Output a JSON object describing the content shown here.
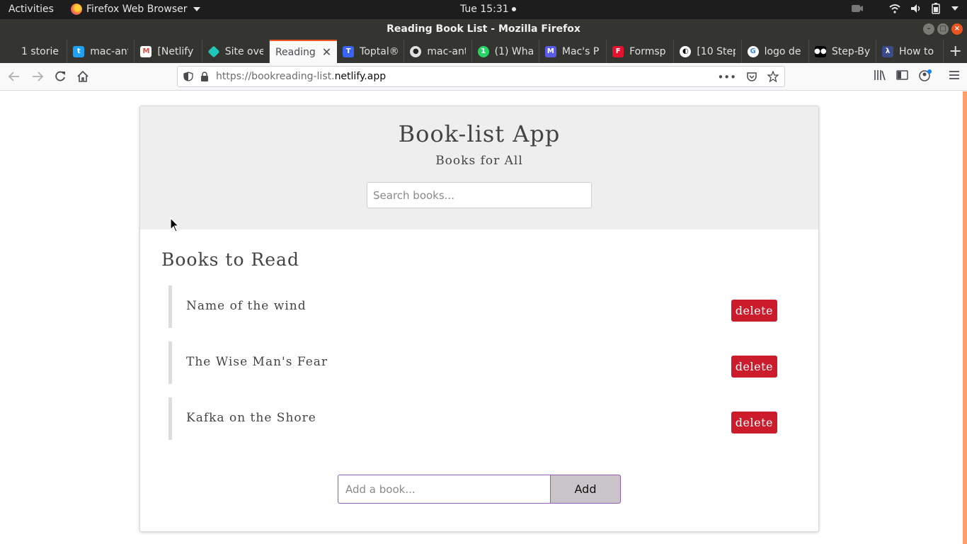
{
  "desktop": {
    "activities": "Activities",
    "app_menu": "Firefox Web Browser",
    "clock": "Tue 15:31"
  },
  "window": {
    "title": "Reading Book List - Mozilla Firefox"
  },
  "tabs": [
    {
      "label": "1 storie",
      "icon": "tab-icon",
      "color": "#343431"
    },
    {
      "label": "mac-ant",
      "icon": "twitter-icon",
      "color": "#1da1f2"
    },
    {
      "label": "[Netlify",
      "icon": "gmail-icon",
      "color": "#ea4335"
    },
    {
      "label": "Site ove",
      "icon": "netlify-icon",
      "color": "#20c6b7"
    },
    {
      "label": "Reading",
      "icon": "none",
      "color": "#f9f9fa",
      "active": true
    },
    {
      "label": "Toptal®",
      "icon": "toptal-icon",
      "color": "#3863f5"
    },
    {
      "label": "mac-ant",
      "icon": "github-icon",
      "color": "#e0e0e0"
    },
    {
      "label": "(1) Wha",
      "icon": "whatsapp-icon",
      "color": "#25d366"
    },
    {
      "label": "Mac's P",
      "icon": "mac-icon",
      "color": "#5a5ce6"
    },
    {
      "label": "Formsp",
      "icon": "formspree-icon",
      "color": "#e5122e"
    },
    {
      "label": "[10 Step",
      "icon": "yin-yang-icon",
      "color": "#ffffff"
    },
    {
      "label": "logo de",
      "icon": "google-icon",
      "color": "#4285f4"
    },
    {
      "label": "Step-By",
      "icon": "medium-icon",
      "color": "#000000"
    },
    {
      "label": "How to",
      "icon": "lambda-icon",
      "color": "#3b4a8a"
    }
  ],
  "urlbar": {
    "url_prefix": "https://bookreading-list.",
    "url_domain": "netlify.app"
  },
  "app": {
    "title": "Book-list App",
    "subtitle": "Books for All",
    "search_placeholder": "Search books...",
    "list_title": "Books to Read",
    "books": [
      {
        "name": "Name of the wind",
        "delete_label": "delete"
      },
      {
        "name": "The Wise Man's Fear",
        "delete_label": "delete"
      },
      {
        "name": "Kafka on the Shore",
        "delete_label": "delete"
      }
    ],
    "add_placeholder": "Add a book...",
    "add_label": "Add",
    "colors": {
      "delete": "#cc1b2b",
      "header_bg": "#eeeeee",
      "add_border": "#9b59b6"
    }
  }
}
